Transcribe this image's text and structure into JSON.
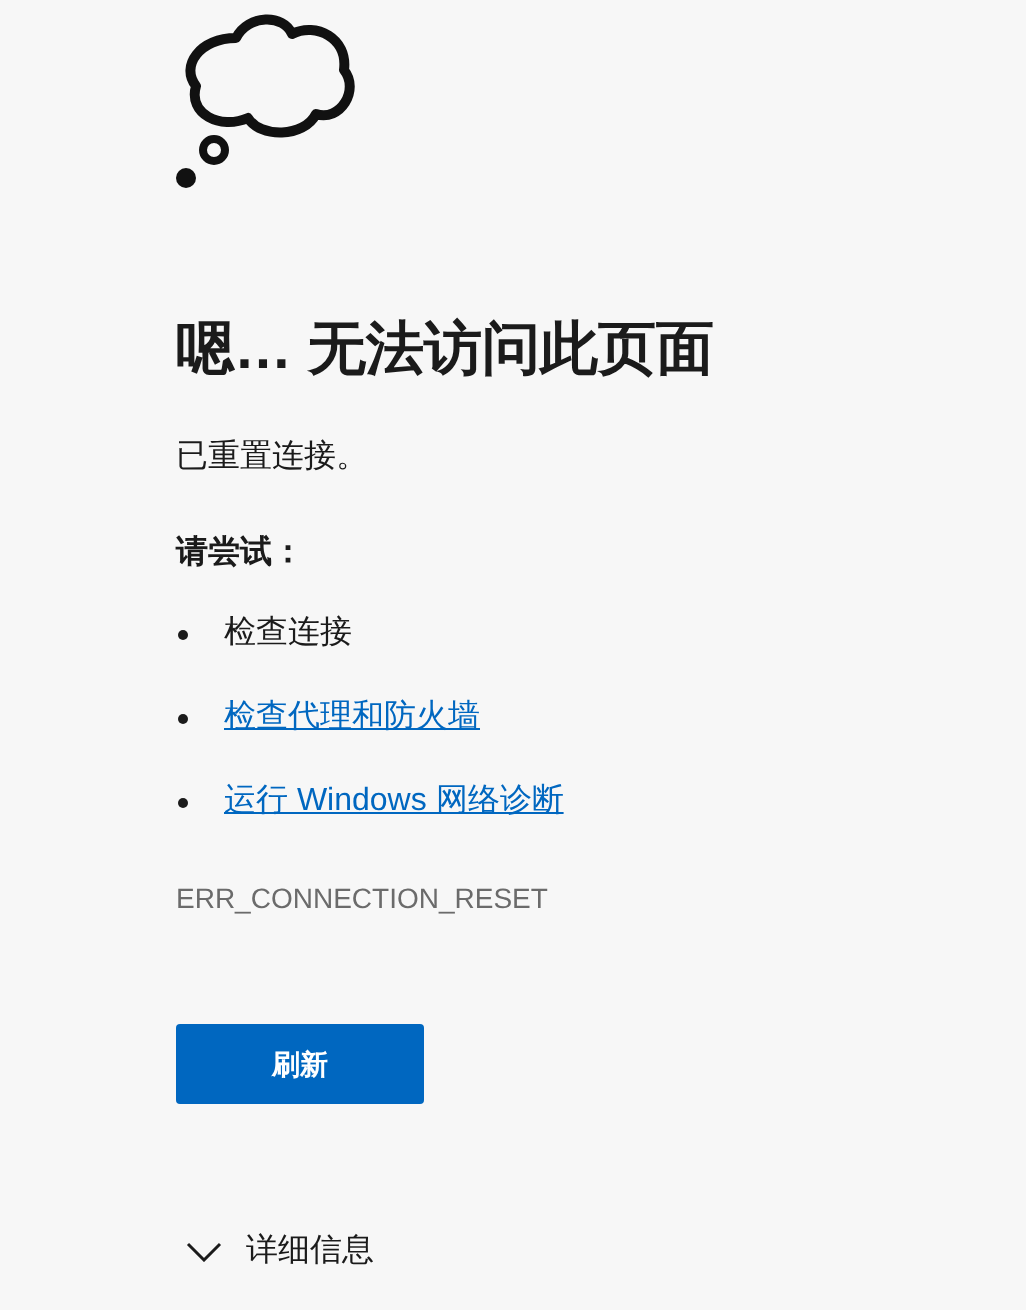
{
  "heading": "嗯… 无法访问此页面",
  "message": "已重置连接。",
  "suggestions_title": "请尝试：",
  "suggestions": [
    {
      "kind": "text",
      "label": "检查连接"
    },
    {
      "kind": "link",
      "label": "检查代理和防火墙"
    },
    {
      "kind": "link",
      "label": "运行 Windows 网络诊断"
    }
  ],
  "error_code": "ERR_CONNECTION_RESET",
  "refresh_button": "刷新",
  "details": {
    "label": "详细信息",
    "expanded": false
  }
}
